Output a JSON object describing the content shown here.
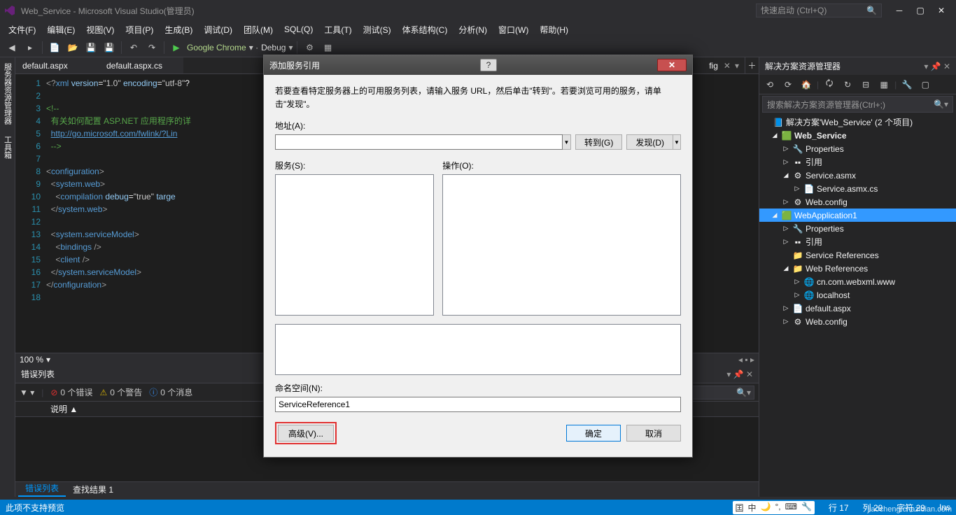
{
  "titlebar": {
    "title": "Web_Service - Microsoft Visual Studio(管理员)",
    "quick_launch": "快速启动 (Ctrl+Q)"
  },
  "menubar": {
    "items": [
      "文件(F)",
      "编辑(E)",
      "视图(V)",
      "项目(P)",
      "生成(B)",
      "调试(D)",
      "团队(M)",
      "SQL(Q)",
      "工具(T)",
      "测试(S)",
      "体系结构(C)",
      "分析(N)",
      "窗口(W)",
      "帮助(H)"
    ]
  },
  "toolbar": {
    "run_label": "Google Chrome",
    "config_label": "Debug"
  },
  "left_tabs": [
    "服务器资源管理器",
    "工具箱"
  ],
  "doc_tabs": {
    "items": [
      "default.aspx",
      "default.aspx.cs"
    ],
    "extra_tab": "fig"
  },
  "editor": {
    "zoom": "100 %",
    "lines": [
      {
        "n": 1,
        "html": "<span class='gray'>&lt;?</span><span class='blue'>xml</span> <span class='attr'>version</span>=<span class='str'>\"1.0\"</span> <span class='attr'>encoding</span>=<span class='str'>\"utf-8\"</span>?"
      },
      {
        "n": 2,
        "html": ""
      },
      {
        "n": 3,
        "html": "<span class='comment'>&lt;!--</span>"
      },
      {
        "n": 4,
        "html": "  <span class='comment'>有关如何配置 ASP.NET 应用程序的详</span>"
      },
      {
        "n": 5,
        "html": "  <span class='link'>http://go.microsoft.com/fwlink/?Lin</span>"
      },
      {
        "n": 6,
        "html": "  <span class='comment'>--&gt;</span>"
      },
      {
        "n": 7,
        "html": ""
      },
      {
        "n": 8,
        "html": "<span class='gray'>&lt;</span><span class='blue'>configuration</span><span class='gray'>&gt;</span>"
      },
      {
        "n": 9,
        "html": "  <span class='gray'>&lt;</span><span class='blue'>system.web</span><span class='gray'>&gt;</span>"
      },
      {
        "n": 10,
        "html": "    <span class='gray'>&lt;</span><span class='blue'>compilation</span> <span class='attr'>debug</span>=<span class='str'>\"true\"</span> <span class='attr'>targe</span>"
      },
      {
        "n": 11,
        "html": "  <span class='gray'>&lt;/</span><span class='blue'>system.web</span><span class='gray'>&gt;</span>"
      },
      {
        "n": 12,
        "html": ""
      },
      {
        "n": 13,
        "html": "  <span class='gray'>&lt;</span><span class='blue'>system.serviceModel</span><span class='gray'>&gt;</span>"
      },
      {
        "n": 14,
        "html": "    <span class='gray'>&lt;</span><span class='blue'>bindings</span> <span class='gray'>/&gt;</span>"
      },
      {
        "n": 15,
        "html": "    <span class='gray'>&lt;</span><span class='blue'>client</span> <span class='gray'>/&gt;</span>"
      },
      {
        "n": 16,
        "html": "  <span class='gray'>&lt;/</span><span class='blue'>system.serviceModel</span><span class='gray'>&gt;</span>"
      },
      {
        "n": 17,
        "html": "<span class='gray'>&lt;/</span><span class='blue'>configuration</span><span class='gray'>&gt;</span>"
      },
      {
        "n": 18,
        "html": ""
      }
    ]
  },
  "error_list": {
    "title": "错误列表",
    "filters": {
      "errors": "0 个错误",
      "warnings": "0 个警告",
      "messages": "0 个消息"
    },
    "header_desc": "说明 ▲"
  },
  "bottom_tabs": {
    "active": "错误列表",
    "inactive": "查找结果 1"
  },
  "solution_explorer": {
    "title": "解决方案资源管理器",
    "search_placeholder": "搜索解决方案资源管理器(Ctrl+;)",
    "nodes": {
      "solution": "解决方案'Web_Service' (2 个项目)",
      "proj1": "Web_Service",
      "p1_properties": "Properties",
      "p1_refs": "引用",
      "p1_asmx": "Service.asmx",
      "p1_asmxcs": "Service.asmx.cs",
      "p1_config": "Web.config",
      "proj2": "WebApplication1",
      "p2_properties": "Properties",
      "p2_refs": "引用",
      "p2_servicerefs": "Service References",
      "p2_webrefs": "Web References",
      "p2_wr1": "cn.com.webxml.www",
      "p2_wr2": "localhost",
      "p2_default": "default.aspx",
      "p2_config": "Web.config"
    }
  },
  "dialog": {
    "title": "添加服务引用",
    "instruction": "若要查看特定服务器上的可用服务列表，请输入服务 URL，然后单击\"转到\"。若要浏览可用的服务，请单击\"发现\"。",
    "address_label": "地址(A):",
    "goto_btn": "转到(G)",
    "discover_btn": "发现(D)",
    "services_label": "服务(S):",
    "operations_label": "操作(O):",
    "namespace_label": "命名空间(N):",
    "namespace_value": "ServiceReference1",
    "advanced_btn": "高级(V)...",
    "ok_btn": "确定",
    "cancel_btn": "取消"
  },
  "statusbar": {
    "msg": "此项不支持预览",
    "line": "行 17",
    "col": "列 29",
    "char": "字符 29",
    "ins": "Ins",
    "watermark": "jiaocheng.chazidian.com"
  }
}
